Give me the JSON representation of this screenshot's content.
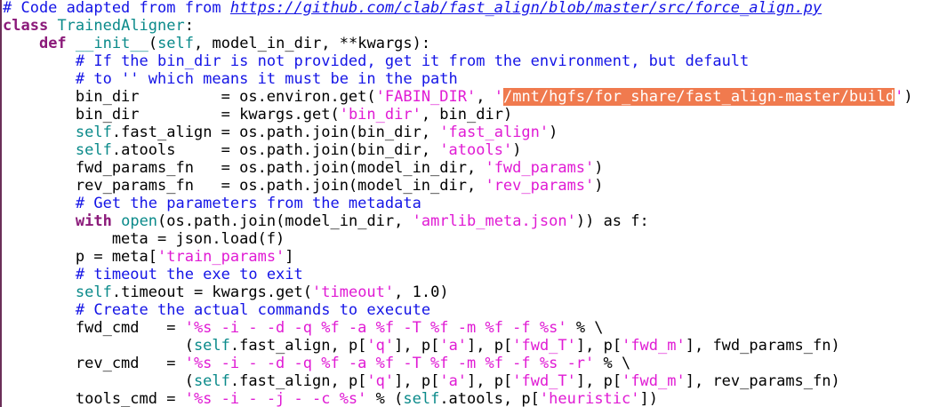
{
  "editor": {
    "lines": [
      {
        "segs": [
          {
            "c": "cmt",
            "t": "# Code adapted from from "
          },
          {
            "c": "cmt url",
            "t": "https://github.com/clab/fast_align/blob/master/src/force_align.py"
          }
        ]
      },
      {
        "segs": [
          {
            "c": "kw",
            "t": "class"
          },
          {
            "c": "",
            "t": " "
          },
          {
            "c": "cls",
            "t": "TrainedAligner"
          },
          {
            "c": "",
            "t": ":"
          }
        ]
      },
      {
        "segs": [
          {
            "c": "",
            "t": "    "
          },
          {
            "c": "kw",
            "t": "def"
          },
          {
            "c": "",
            "t": " "
          },
          {
            "c": "dnd",
            "t": "__init__"
          },
          {
            "c": "",
            "t": "("
          },
          {
            "c": "slf",
            "t": "self"
          },
          {
            "c": "",
            "t": ", model_in_dir, **kwargs):"
          }
        ]
      },
      {
        "segs": [
          {
            "c": "",
            "t": "        "
          },
          {
            "c": "cmt",
            "t": "# If the bin_dir is not provided, get it from the environment, but default"
          }
        ]
      },
      {
        "segs": [
          {
            "c": "",
            "t": "        "
          },
          {
            "c": "cmt",
            "t": "# to '' which means it must be in the path"
          }
        ]
      },
      {
        "segs": [
          {
            "c": "",
            "t": "        bin_dir         = os.environ.get("
          },
          {
            "c": "str",
            "t": "'FABIN_DIR'"
          },
          {
            "c": "",
            "t": ", "
          },
          {
            "c": "str",
            "t": "'"
          },
          {
            "c": "str hl",
            "t": "/mnt/hgfs/for_share/fast_align-master/build"
          },
          {
            "c": "str",
            "t": "'"
          },
          {
            "c": "",
            "t": ")"
          }
        ]
      },
      {
        "segs": [
          {
            "c": "",
            "t": "        bin_dir         = kwargs.get("
          },
          {
            "c": "str",
            "t": "'bin_dir'"
          },
          {
            "c": "",
            "t": ", bin_dir)"
          }
        ]
      },
      {
        "segs": [
          {
            "c": "",
            "t": "        "
          },
          {
            "c": "slf",
            "t": "self"
          },
          {
            "c": "",
            "t": ".fast_align = os.path.join(bin_dir, "
          },
          {
            "c": "str",
            "t": "'fast_align'"
          },
          {
            "c": "",
            "t": ")"
          }
        ]
      },
      {
        "segs": [
          {
            "c": "",
            "t": "        "
          },
          {
            "c": "slf",
            "t": "self"
          },
          {
            "c": "",
            "t": ".atools     = os.path.join(bin_dir, "
          },
          {
            "c": "str",
            "t": "'atools'"
          },
          {
            "c": "",
            "t": ")"
          }
        ]
      },
      {
        "segs": [
          {
            "c": "",
            "t": "        fwd_params_fn   = os.path.join(model_in_dir, "
          },
          {
            "c": "str",
            "t": "'fwd_params'"
          },
          {
            "c": "",
            "t": ")"
          }
        ]
      },
      {
        "segs": [
          {
            "c": "",
            "t": "        rev_params_fn   = os.path.join(model_in_dir, "
          },
          {
            "c": "str",
            "t": "'rev_params'"
          },
          {
            "c": "",
            "t": ")"
          }
        ]
      },
      {
        "segs": [
          {
            "c": "",
            "t": "        "
          },
          {
            "c": "cmt",
            "t": "# Get the parameters from the metadata"
          }
        ]
      },
      {
        "segs": [
          {
            "c": "",
            "t": "        "
          },
          {
            "c": "kw",
            "t": "with"
          },
          {
            "c": "",
            "t": " "
          },
          {
            "c": "bi",
            "t": "open"
          },
          {
            "c": "",
            "t": "(os.path.join(model_in_dir, "
          },
          {
            "c": "str",
            "t": "'amrlib_meta.json'"
          },
          {
            "c": "",
            "t": ")) as f:"
          }
        ]
      },
      {
        "segs": [
          {
            "c": "",
            "t": "            meta = json.load(f)"
          }
        ]
      },
      {
        "segs": [
          {
            "c": "",
            "t": "        p = meta["
          },
          {
            "c": "str",
            "t": "'train_params'"
          },
          {
            "c": "",
            "t": "]"
          }
        ]
      },
      {
        "segs": [
          {
            "c": "",
            "t": "        "
          },
          {
            "c": "cmt",
            "t": "# timeout the exe to exit"
          }
        ]
      },
      {
        "segs": [
          {
            "c": "",
            "t": "        "
          },
          {
            "c": "slf",
            "t": "self"
          },
          {
            "c": "",
            "t": ".timeout = kwargs.get("
          },
          {
            "c": "str",
            "t": "'timeout'"
          },
          {
            "c": "",
            "t": ", 1.0)"
          }
        ]
      },
      {
        "segs": [
          {
            "c": "",
            "t": "        "
          },
          {
            "c": "cmt",
            "t": "# Create the actual commands to execute"
          }
        ]
      },
      {
        "segs": [
          {
            "c": "",
            "t": "        fwd_cmd   = "
          },
          {
            "c": "str",
            "t": "'%s -i - -d -q %f -a %f -T %f -m %f -f %s'"
          },
          {
            "c": "",
            "t": " % \\"
          }
        ]
      },
      {
        "segs": [
          {
            "c": "",
            "t": "                    ("
          },
          {
            "c": "slf",
            "t": "self"
          },
          {
            "c": "",
            "t": ".fast_align, p["
          },
          {
            "c": "str",
            "t": "'q'"
          },
          {
            "c": "",
            "t": "], p["
          },
          {
            "c": "str",
            "t": "'a'"
          },
          {
            "c": "",
            "t": "], p["
          },
          {
            "c": "str",
            "t": "'fwd_T'"
          },
          {
            "c": "",
            "t": "], p["
          },
          {
            "c": "str",
            "t": "'fwd_m'"
          },
          {
            "c": "",
            "t": "], fwd_params_fn)"
          }
        ]
      },
      {
        "segs": [
          {
            "c": "",
            "t": "        rev_cmd   = "
          },
          {
            "c": "str",
            "t": "'%s -i - -d -q %f -a %f -T %f -m %f -f %s -r'"
          },
          {
            "c": "",
            "t": " % \\"
          }
        ]
      },
      {
        "segs": [
          {
            "c": "",
            "t": "                    ("
          },
          {
            "c": "slf",
            "t": "self"
          },
          {
            "c": "",
            "t": ".fast_align, p["
          },
          {
            "c": "str",
            "t": "'q'"
          },
          {
            "c": "",
            "t": "], p["
          },
          {
            "c": "str",
            "t": "'a'"
          },
          {
            "c": "",
            "t": "], p["
          },
          {
            "c": "str",
            "t": "'fwd_T'"
          },
          {
            "c": "",
            "t": "], p["
          },
          {
            "c": "str",
            "t": "'fwd_m'"
          },
          {
            "c": "",
            "t": "], rev_params_fn)"
          }
        ]
      },
      {
        "segs": [
          {
            "c": "",
            "t": "        tools_cmd = "
          },
          {
            "c": "str",
            "t": "'%s -i - -j - -c %s'"
          },
          {
            "c": "",
            "t": " % ("
          },
          {
            "c": "slf",
            "t": "self"
          },
          {
            "c": "",
            "t": ".atools, p["
          },
          {
            "c": "str",
            "t": "'heuristic'"
          },
          {
            "c": "",
            "t": "])"
          }
        ]
      }
    ]
  }
}
